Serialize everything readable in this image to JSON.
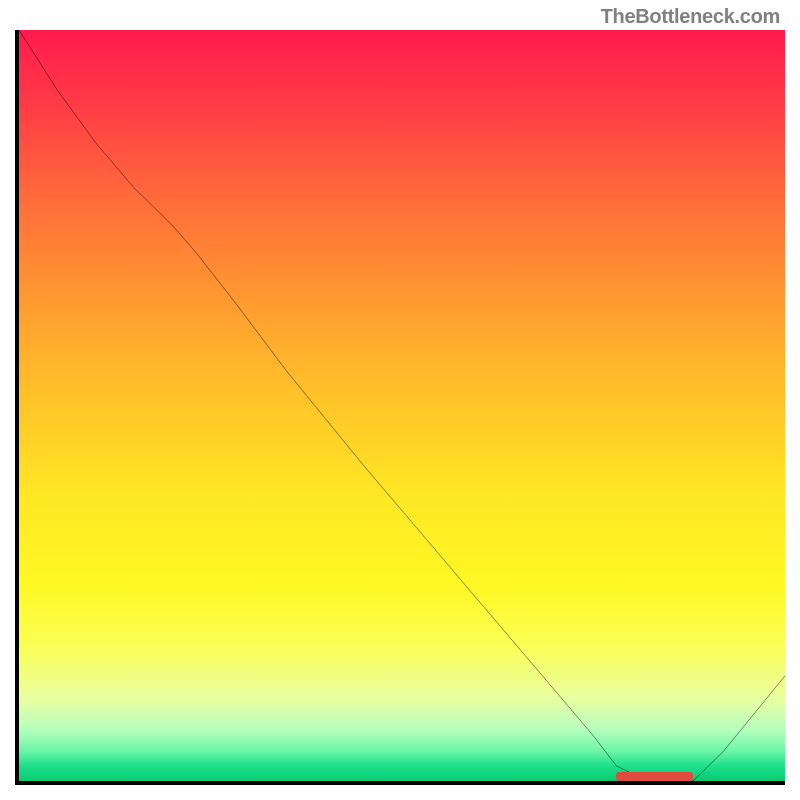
{
  "attribution": "TheBottleneck.com",
  "chart_data": {
    "type": "line",
    "title": "",
    "xlabel": "",
    "ylabel": "",
    "x": [
      0.0,
      0.05,
      0.1,
      0.15,
      0.2,
      0.23,
      0.28,
      0.35,
      0.45,
      0.55,
      0.65,
      0.75,
      0.78,
      0.82,
      0.85,
      0.88,
      0.92,
      0.96,
      1.0
    ],
    "values": [
      1.0,
      0.92,
      0.85,
      0.79,
      0.74,
      0.705,
      0.64,
      0.545,
      0.42,
      0.3,
      0.18,
      0.06,
      0.02,
      0.0,
      0.0,
      0.0,
      0.04,
      0.09,
      0.14
    ],
    "xlim": [
      0,
      1
    ],
    "ylim": [
      0,
      1
    ],
    "annotations": [
      {
        "type": "valley_marker",
        "x_start": 0.78,
        "x_end": 0.88,
        "y": 0.0
      }
    ],
    "grid": false,
    "legend": false
  },
  "colors": {
    "line": "#000000",
    "axes": "#000000",
    "valley_marker": "#e04a3f"
  }
}
